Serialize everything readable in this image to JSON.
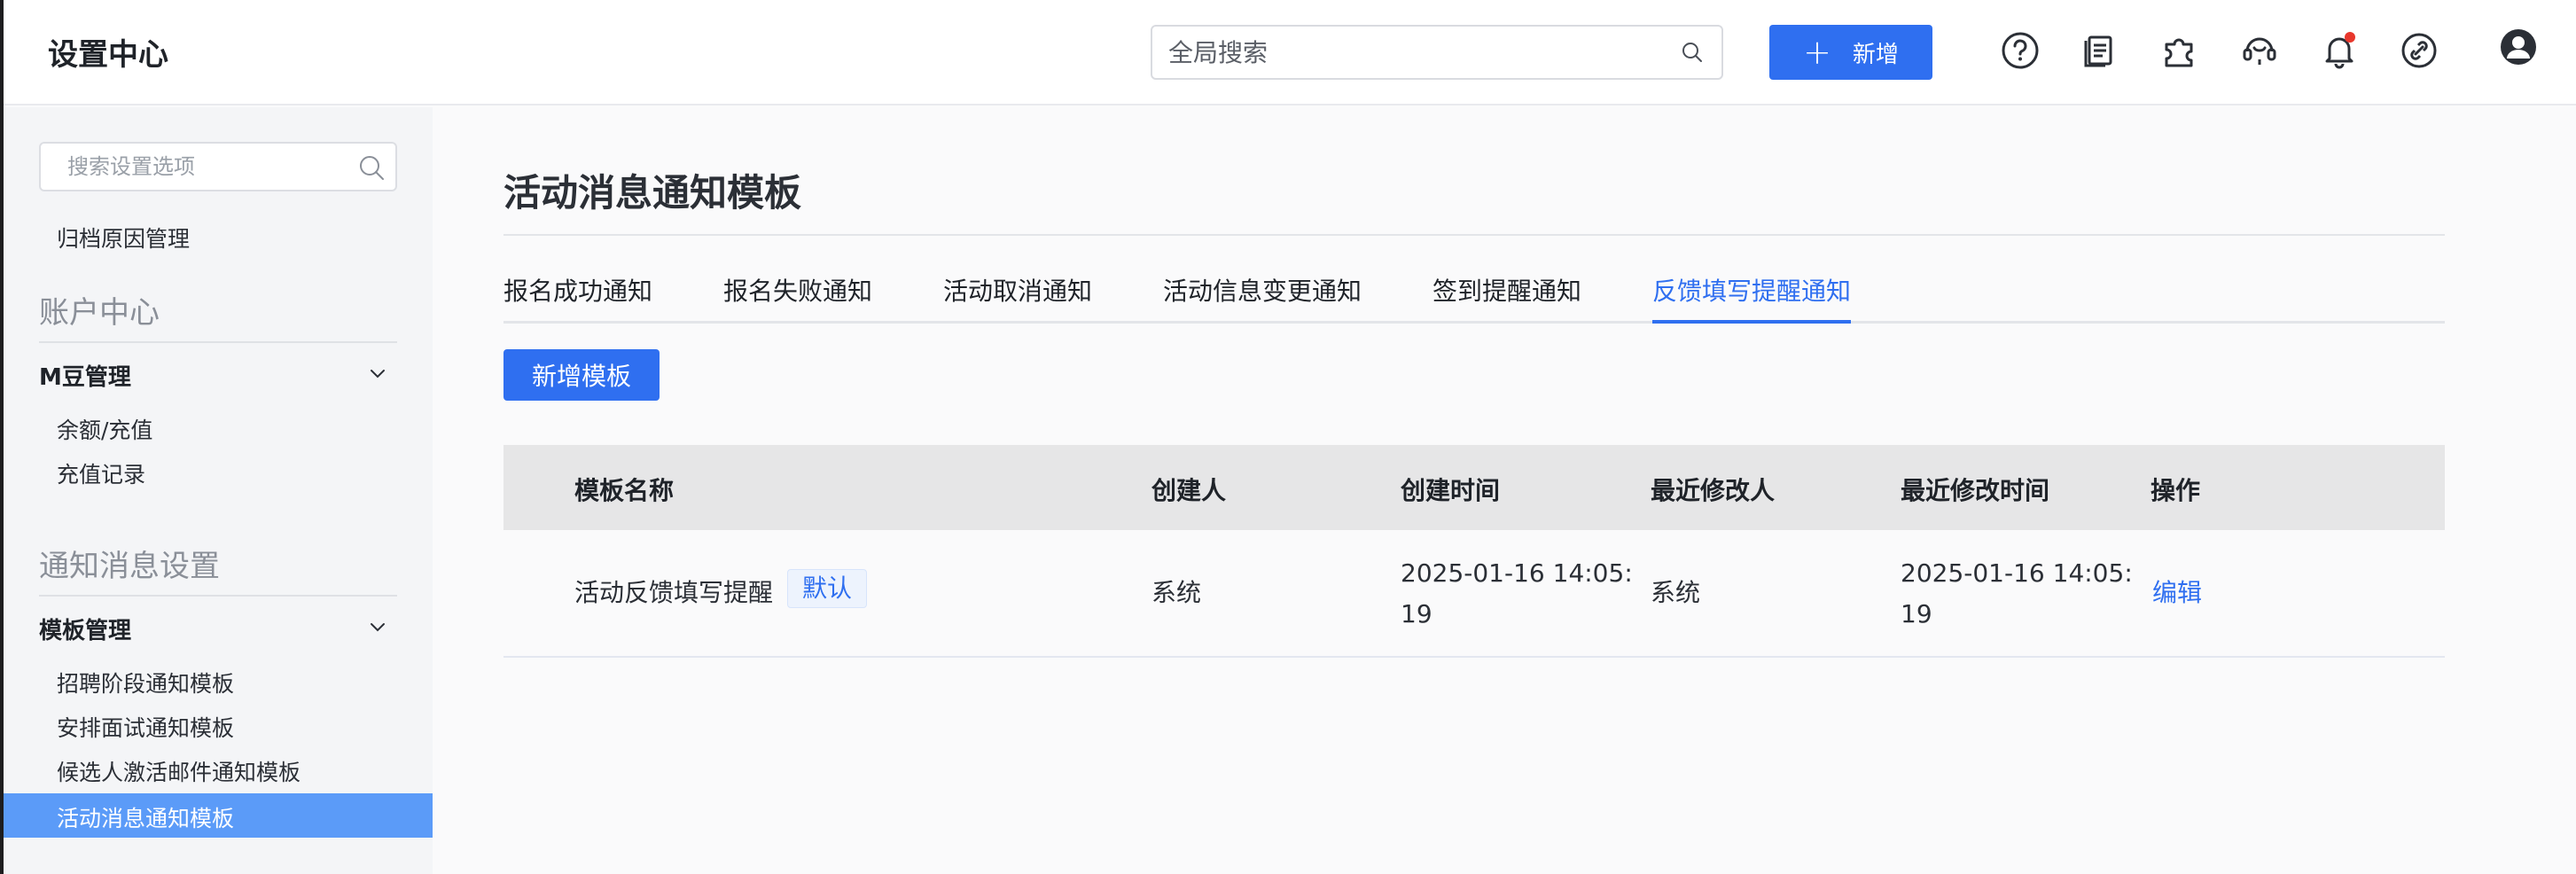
{
  "header": {
    "app_title": "设置中心",
    "search_placeholder": "全局搜索",
    "add_button_label": "新增",
    "icons": [
      "help-circle-icon",
      "document-icon",
      "puzzle-icon",
      "support-agent-icon",
      "bell-icon",
      "link-icon",
      "user-avatar-icon"
    ]
  },
  "sidebar": {
    "search_placeholder": "搜索设置选项",
    "top_link": "归档原因管理",
    "sections": [
      {
        "title": "账户中心",
        "group": "M豆管理",
        "items": [
          "余额/充值",
          "充值记录"
        ]
      },
      {
        "title": "通知消息设置",
        "group": "模板管理",
        "items": [
          "招聘阶段通知模板",
          "安排面试通知模板",
          "候选人激活邮件通知模板",
          "活动消息通知模板"
        ]
      }
    ],
    "active_item": "活动消息通知模板"
  },
  "main": {
    "page_title": "活动消息通知模板",
    "tabs": [
      "报名成功通知",
      "报名失败通知",
      "活动取消通知",
      "活动信息变更通知",
      "签到提醒通知",
      "反馈填写提醒通知"
    ],
    "active_tab": "反馈填写提醒通知",
    "new_template_button": "新增模板",
    "table": {
      "columns": [
        "模板名称",
        "创建人",
        "创建时间",
        "最近修改人",
        "最近修改时间",
        "操作"
      ],
      "rows": [
        {
          "name": "活动反馈填写提醒",
          "badge": "默认",
          "creator": "系统",
          "created_line1": "2025-01-16 14:05:",
          "created_line2": "19",
          "modifier": "系统",
          "modified_line1": "2025-01-16 14:05:",
          "modified_line2": "19",
          "action": "编辑"
        }
      ]
    }
  },
  "colors": {
    "primary": "#2f6ff0",
    "sidebar_active": "#5b9bf8",
    "notification_dot": "#e8372c"
  }
}
